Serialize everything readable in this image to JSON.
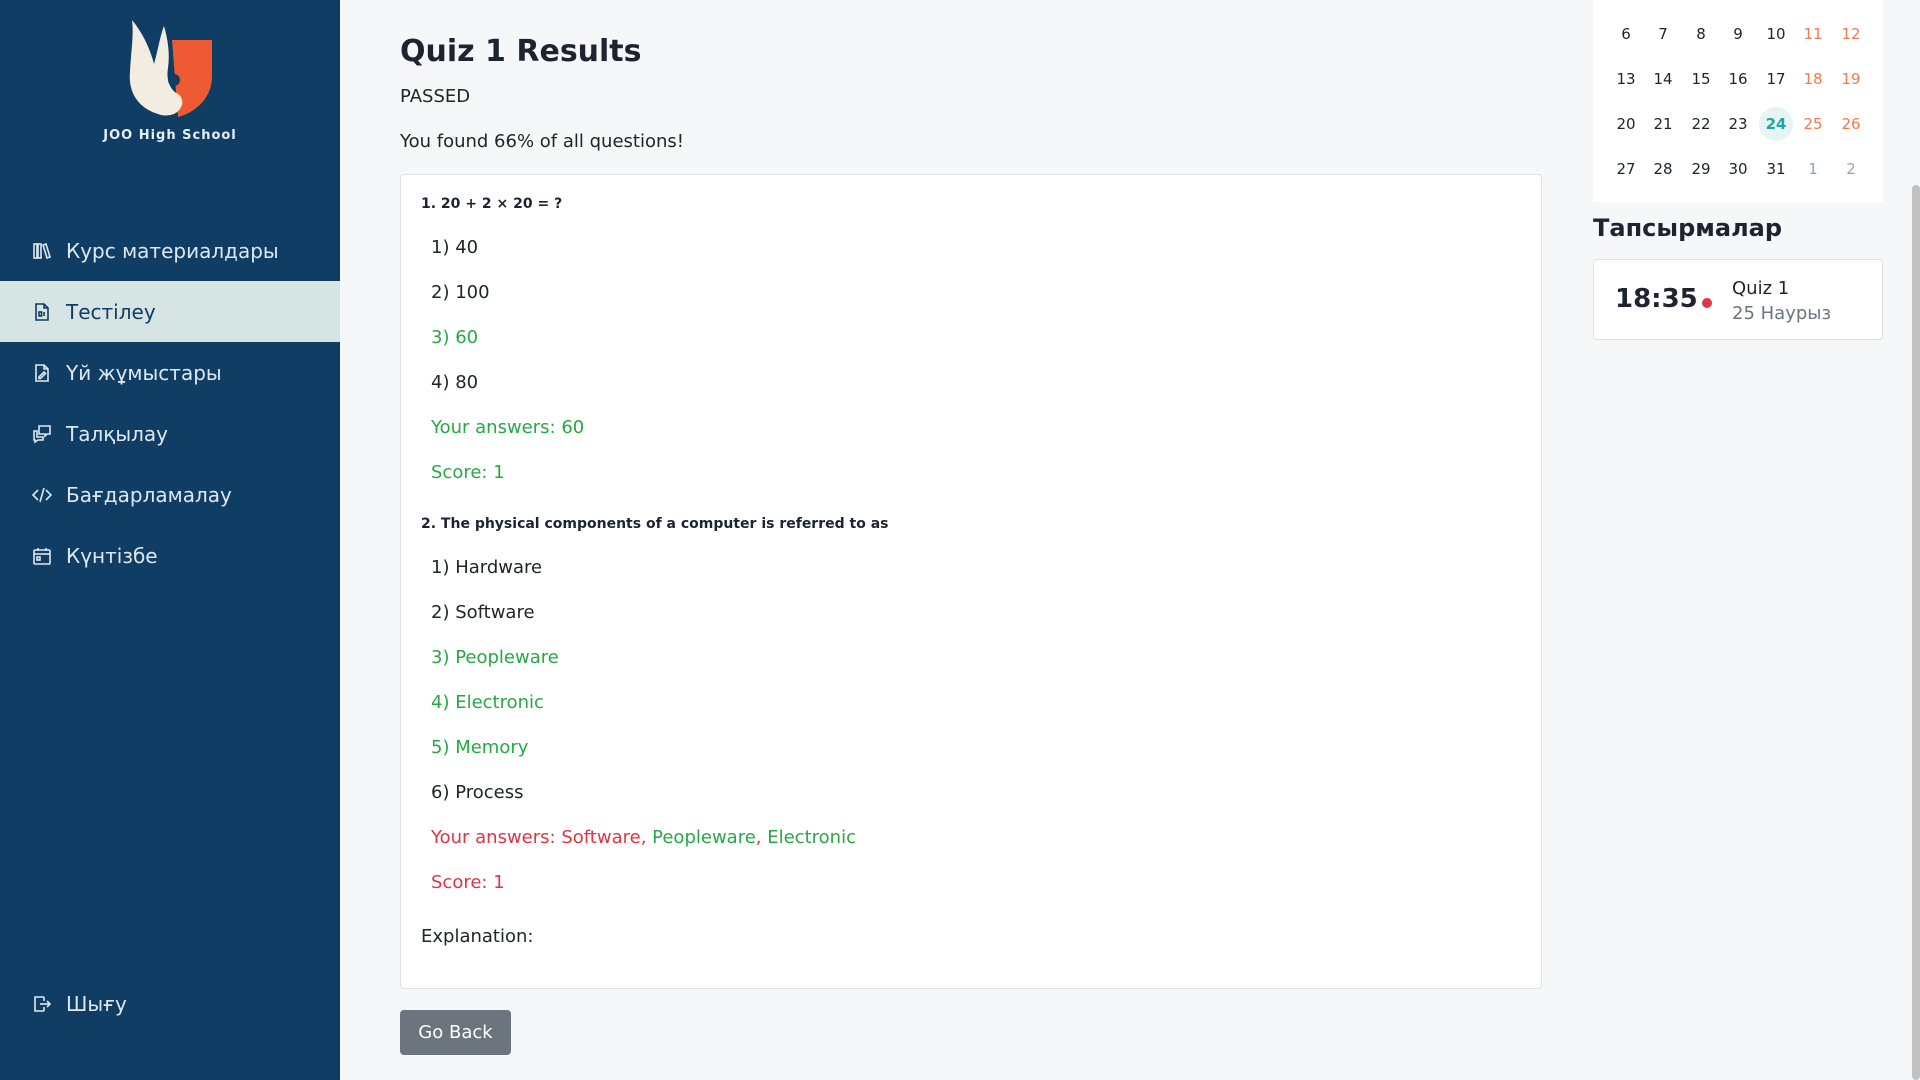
{
  "sidebar": {
    "school_name": "JOO High School",
    "items": [
      {
        "label": "Курс материалдары",
        "icon": "books-icon"
      },
      {
        "label": "Тестілеу",
        "icon": "test-file-icon",
        "active": true
      },
      {
        "label": "Үй жұмыстары",
        "icon": "homework-file-icon"
      },
      {
        "label": "Талқылау",
        "icon": "chat-icon"
      },
      {
        "label": "Бағдарламалау",
        "icon": "code-icon"
      },
      {
        "label": "Күнтізбе",
        "icon": "calendar-icon"
      }
    ],
    "logout": {
      "label": "Шығу",
      "icon": "logout-icon"
    }
  },
  "main": {
    "title": "Quiz 1 Results",
    "status": "PASSED",
    "found_text": "You found 66% of all questions!",
    "questions": [
      {
        "title": "1. 20 + 2 × 20 = ?",
        "options": [
          {
            "text": "1) 40",
            "correct": false
          },
          {
            "text": "2) 100",
            "correct": false
          },
          {
            "text": "3) 60",
            "correct": true
          },
          {
            "text": "4) 80",
            "correct": false
          }
        ],
        "answers_label": "Your answers: ",
        "answers": [
          {
            "text": "60",
            "correct": true
          }
        ],
        "score": "Score: 1"
      },
      {
        "title": "2. The physical components of a computer is referred to as",
        "options": [
          {
            "text": "1) Hardware",
            "correct": false
          },
          {
            "text": "2) Software",
            "correct": false
          },
          {
            "text": "3) Peopleware",
            "correct": true
          },
          {
            "text": "4) Electronic",
            "correct": true
          },
          {
            "text": "5) Memory",
            "correct": true
          },
          {
            "text": "6) Process",
            "correct": false
          }
        ],
        "answers_label": "Your answers: ",
        "answers": [
          {
            "text": "Software",
            "correct": false
          },
          {
            "text": "Peopleware",
            "correct": true
          },
          {
            "text": "Electronic",
            "correct": true
          }
        ],
        "separator": ", ",
        "score": "Score: 1"
      }
    ],
    "explanation": "Explanation:",
    "go_back": "Go Back"
  },
  "calendar": {
    "rows": [
      [
        {
          "d": "6"
        },
        {
          "d": "7"
        },
        {
          "d": "8"
        },
        {
          "d": "9"
        },
        {
          "d": "10"
        },
        {
          "d": "11",
          "weekend": true
        },
        {
          "d": "12",
          "weekend": true
        }
      ],
      [
        {
          "d": "13"
        },
        {
          "d": "14"
        },
        {
          "d": "15"
        },
        {
          "d": "16"
        },
        {
          "d": "17"
        },
        {
          "d": "18",
          "weekend": true
        },
        {
          "d": "19",
          "weekend": true
        }
      ],
      [
        {
          "d": "20"
        },
        {
          "d": "21"
        },
        {
          "d": "22"
        },
        {
          "d": "23"
        },
        {
          "d": "24",
          "today": true
        },
        {
          "d": "25",
          "weekend": true
        },
        {
          "d": "26",
          "weekend": true
        }
      ],
      [
        {
          "d": "27"
        },
        {
          "d": "28"
        },
        {
          "d": "29"
        },
        {
          "d": "30"
        },
        {
          "d": "31"
        },
        {
          "d": "1",
          "other": true
        },
        {
          "d": "2",
          "other": true
        }
      ]
    ]
  },
  "tasks": {
    "title": "Тапсырмалар",
    "items": [
      {
        "time": "18:35",
        "name": "Quiz 1",
        "date": "25 Наурыз"
      }
    ]
  },
  "colors": {
    "sidebar": "#0f3d63",
    "active_item": "#d6e4e4",
    "correct": "#28a745",
    "wrong": "#dc3545",
    "weekend": "#f07b4f",
    "today": "#1fa6a6"
  }
}
